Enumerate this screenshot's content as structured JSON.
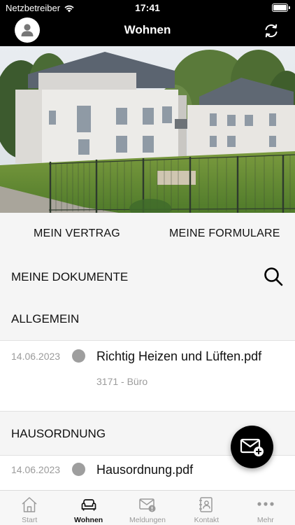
{
  "status_bar": {
    "carrier": "Netzbetreiber",
    "time": "17:41"
  },
  "header": {
    "title": "Wohnen"
  },
  "links": {
    "contract": "MEIN VERTRAG",
    "forms": "MEINE FORMULARE"
  },
  "documents": {
    "title": "MEINE DOKUMENTE",
    "sections": [
      {
        "title": "ALLGEMEIN",
        "items": [
          {
            "date": "14.06.2023",
            "name": "Richtig Heizen und Lüften.pdf",
            "sub": "3171 - Büro"
          }
        ]
      },
      {
        "title": "HAUSORDNUNG",
        "items": [
          {
            "date": "14.06.2023",
            "name": "Hausordnung.pdf"
          }
        ]
      }
    ]
  },
  "tabs": [
    {
      "label": "Start",
      "icon": "home-icon",
      "active": false
    },
    {
      "label": "Wohnen",
      "icon": "sofa-icon",
      "active": true
    },
    {
      "label": "Meldungen",
      "icon": "mail-alert-icon",
      "active": false
    },
    {
      "label": "Kontakt",
      "icon": "contacts-book-icon",
      "active": false
    },
    {
      "label": "Mehr",
      "icon": "more-dots-icon",
      "active": false
    }
  ],
  "colors": {
    "bar": "#000000",
    "content_bg": "#f5f5f5",
    "dot": "#9e9e9e",
    "muted_text": "#9b9b9b"
  }
}
